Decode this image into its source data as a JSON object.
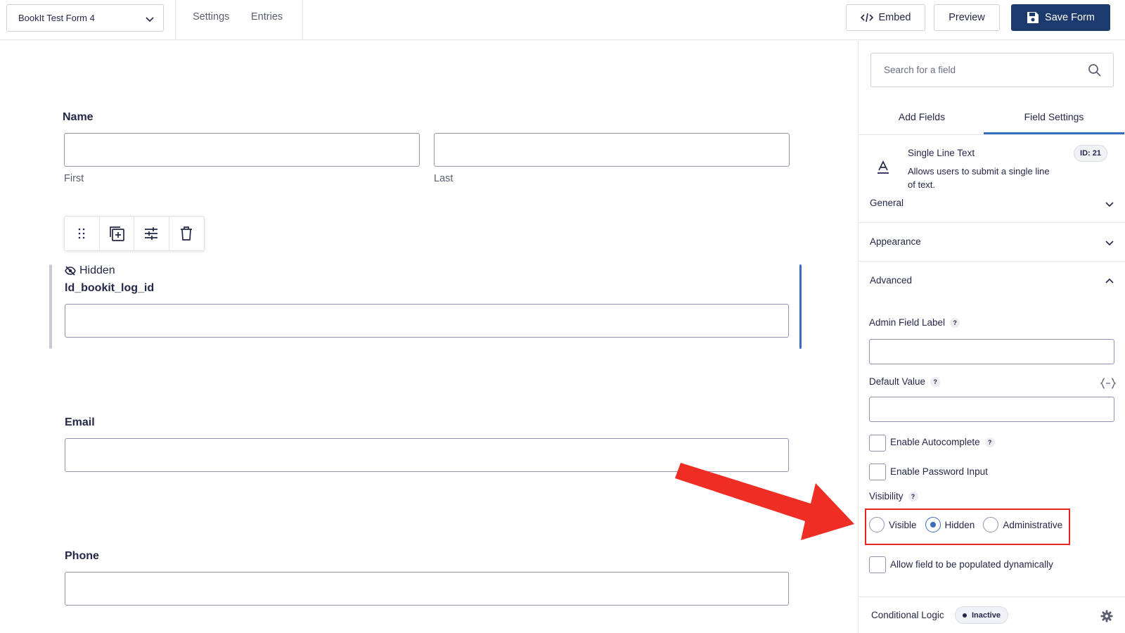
{
  "topbar": {
    "form_name": "BookIt Test Form 4",
    "settings_label": "Settings",
    "entries_label": "Entries",
    "embed_label": "Embed",
    "preview_label": "Preview",
    "save_label": "Save Form"
  },
  "canvas": {
    "name_field": {
      "label": "Name",
      "first_label": "First",
      "last_label": "Last"
    },
    "hidden_field": {
      "hidden_tag": "Hidden",
      "label": "ld_bookit_log_id"
    },
    "email_field": {
      "label": "Email"
    },
    "phone_field": {
      "label": "Phone"
    },
    "toolbar_icons": [
      "drag-handle-icon",
      "duplicate-icon",
      "settings-sliders-icon",
      "trash-icon"
    ]
  },
  "sidebar": {
    "search_placeholder": "Search for a field",
    "tabs": {
      "add_fields": "Add Fields",
      "field_settings": "Field Settings"
    },
    "field_type": {
      "title": "Single Line Text",
      "description": "Allows users to submit a single line of text.",
      "id_badge": "ID: 21"
    },
    "sections": {
      "general": "General",
      "appearance": "Appearance",
      "advanced": "Advanced"
    },
    "advanced": {
      "admin_field_label": "Admin Field Label",
      "default_value": "Default Value",
      "enable_autocomplete": "Enable Autocomplete",
      "enable_password_input": "Enable Password Input",
      "visibility_label": "Visibility",
      "visibility_options": {
        "visible": "Visible",
        "hidden": "Hidden",
        "administrative": "Administrative"
      },
      "visibility_selected": "Hidden",
      "populate_dynamically": "Allow field to be populated dynamically",
      "help_mark": "?"
    },
    "conditional_logic": {
      "label": "Conditional Logic",
      "status": "Inactive"
    }
  },
  "colors": {
    "primary": "#1d3a6e",
    "accent": "#3a6dbb",
    "annotation_red": "#e5261f",
    "text": "#242748"
  }
}
